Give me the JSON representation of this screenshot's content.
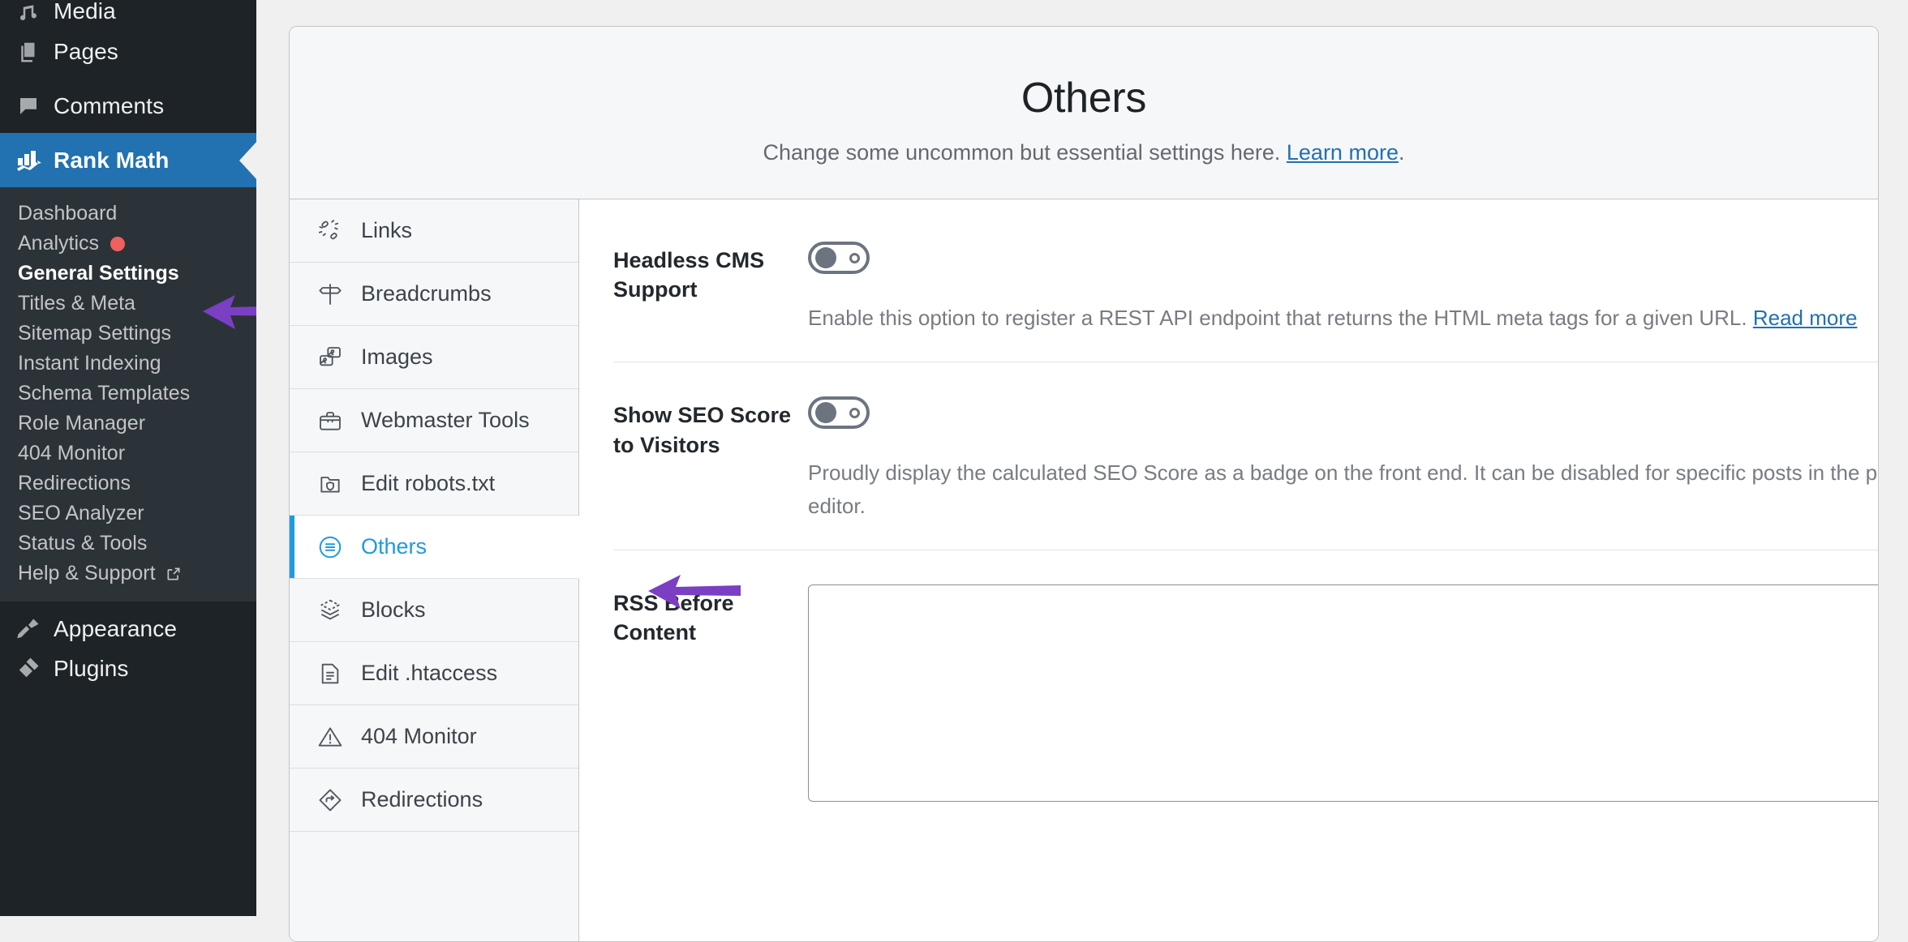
{
  "wp_sidebar": {
    "top_items": [
      {
        "label": "Media",
        "icon": "media-icon",
        "state": "partial"
      },
      {
        "label": "Pages",
        "icon": "pages-icon",
        "state": "normal"
      },
      {
        "label": "Comments",
        "icon": "comments-icon",
        "state": "normal"
      }
    ],
    "active_item": {
      "label": "Rank Math",
      "icon": "rank-math-icon"
    },
    "submenu": [
      {
        "label": "Dashboard",
        "current": false,
        "badge": null,
        "external": false
      },
      {
        "label": "Analytics",
        "current": false,
        "badge": "red-dot",
        "external": false
      },
      {
        "label": "General Settings",
        "current": true,
        "badge": null,
        "external": false
      },
      {
        "label": "Titles & Meta",
        "current": false,
        "badge": null,
        "external": false
      },
      {
        "label": "Sitemap Settings",
        "current": false,
        "badge": null,
        "external": false
      },
      {
        "label": "Instant Indexing",
        "current": false,
        "badge": null,
        "external": false
      },
      {
        "label": "Schema Templates",
        "current": false,
        "badge": null,
        "external": false
      },
      {
        "label": "Role Manager",
        "current": false,
        "badge": null,
        "external": false
      },
      {
        "label": "404 Monitor",
        "current": false,
        "badge": null,
        "external": false
      },
      {
        "label": "Redirections",
        "current": false,
        "badge": null,
        "external": false
      },
      {
        "label": "SEO Analyzer",
        "current": false,
        "badge": null,
        "external": false
      },
      {
        "label": "Status & Tools",
        "current": false,
        "badge": null,
        "external": false
      },
      {
        "label": "Help & Support",
        "current": false,
        "badge": null,
        "external": true
      }
    ],
    "bottom_items": [
      {
        "label": "Appearance",
        "icon": "appearance-icon",
        "state": "normal"
      },
      {
        "label": "Plugins",
        "icon": "plugins-icon",
        "state": "partial"
      }
    ]
  },
  "header": {
    "title": "Others",
    "subtitle_text": "Change some uncommon but essential settings here. ",
    "subtitle_link": "Learn more",
    "subtitle_tail": "."
  },
  "tabs": [
    {
      "label": "Links",
      "icon": "links-icon",
      "active": false
    },
    {
      "label": "Breadcrumbs",
      "icon": "breadcrumbs-signpost-icon",
      "active": false
    },
    {
      "label": "Images",
      "icon": "images-icon",
      "active": false
    },
    {
      "label": "Webmaster Tools",
      "icon": "toolbox-icon",
      "active": false
    },
    {
      "label": "Edit robots.txt",
      "icon": "robots-folder-icon",
      "active": false
    },
    {
      "label": "Others",
      "icon": "others-list-circle-icon",
      "active": true
    },
    {
      "label": "Blocks",
      "icon": "blocks-layers-icon",
      "active": false
    },
    {
      "label": "Edit .htaccess",
      "icon": "htaccess-file-icon",
      "active": false
    },
    {
      "label": "404 Monitor",
      "icon": "warning-triangle-icon",
      "active": false
    },
    {
      "label": "Redirections",
      "icon": "redirections-diamond-arrow-icon",
      "active": false
    }
  ],
  "settings": [
    {
      "label": "Headless CMS Support",
      "control": "toggle",
      "toggle_state": "off",
      "description_text": "Enable this option to register a REST API endpoint that returns the HTML meta tags for a given URL. ",
      "description_link": "Read more"
    },
    {
      "label": "Show SEO Score to Visitors",
      "control": "toggle",
      "toggle_state": "off",
      "description_text": "Proudly display the calculated SEO Score as a badge on the front end. It can be disabled for specific posts in the post editor.",
      "description_link": null
    },
    {
      "label": "RSS Before Content",
      "control": "textarea",
      "value": "",
      "description_text": null,
      "description_link": null
    }
  ],
  "annotations": [
    {
      "name": "arrow-general-settings",
      "color": "#7b3fc4",
      "direction": "left"
    },
    {
      "name": "arrow-others-tab",
      "color": "#7b3fc4",
      "direction": "left"
    }
  ],
  "colors": {
    "sidebar_bg": "#1d2327",
    "submenu_bg": "#2c3338",
    "wp_blue": "#2271b1",
    "accent_blue": "#1e9ae0",
    "link_blue": "#2271b1",
    "badge_red": "#f0605e",
    "arrow_purple": "#7b3fc4"
  }
}
